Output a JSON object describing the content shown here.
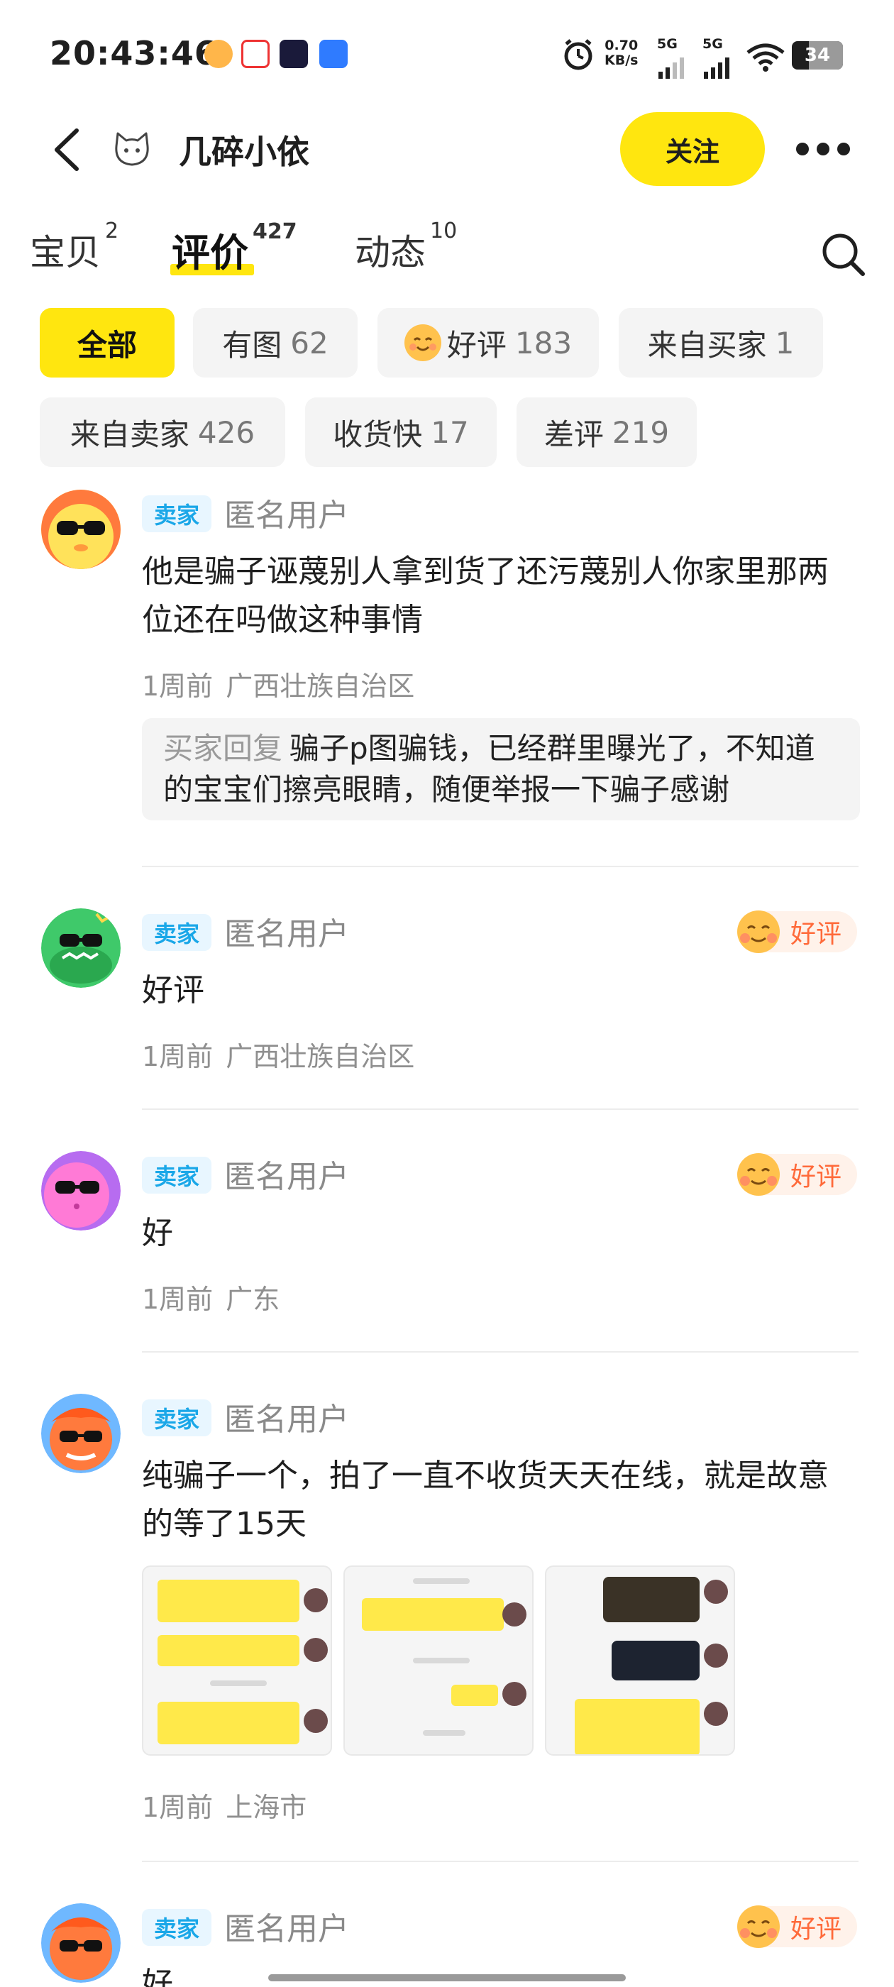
{
  "status_bar": {
    "time": "20:43:46",
    "net_speed": "0.70",
    "net_unit": "KB/s",
    "sim1": "5G",
    "sim2": "5G",
    "battery": "34"
  },
  "header": {
    "shop_name": "几碎小依",
    "follow_label": "关注"
  },
  "tabs": [
    {
      "label": "宝贝",
      "count": "2"
    },
    {
      "label": "评价",
      "count": "427"
    },
    {
      "label": "动态",
      "count": "10"
    }
  ],
  "filters": [
    {
      "label": "全部",
      "count": ""
    },
    {
      "label": "有图",
      "count": "62"
    },
    {
      "label": "好评",
      "count": "183"
    },
    {
      "label": "来自买家",
      "count": "1"
    },
    {
      "label": "来自卖家",
      "count": "426"
    },
    {
      "label": "收货快",
      "count": "17"
    },
    {
      "label": "差评",
      "count": "219"
    }
  ],
  "reviews": [
    {
      "badge": "卖家",
      "user": "匿名用户",
      "content": "他是骗子诬蔑别人拿到货了还污蔑别人你家里那两位还在吗做这种事情",
      "time": "1周前",
      "region": "广西壮族自治区",
      "reply_label": "买家回复",
      "reply_text": "骗子p图骗钱，已经群里曝光了，不知道的宝宝们擦亮眼睛，随便举报一下骗子感谢"
    },
    {
      "badge": "卖家",
      "user": "匿名用户",
      "tag": "好评",
      "content": "好评",
      "time": "1周前",
      "region": "广西壮族自治区"
    },
    {
      "badge": "卖家",
      "user": "匿名用户",
      "tag": "好评",
      "content": "好",
      "time": "1周前",
      "region": "广东"
    },
    {
      "badge": "卖家",
      "user": "匿名用户",
      "content": "纯骗子一个，拍了一直不收货天天在线，就是故意的等了15天",
      "time": "1周前",
      "region": "上海市"
    },
    {
      "badge": "卖家",
      "user": "匿名用户",
      "tag": "好评",
      "content": "好"
    }
  ],
  "colors": {
    "accent_yellow": "#ffe60f",
    "seller_badge": "#1aa7e8",
    "good_tag": "#ff6a3a"
  }
}
